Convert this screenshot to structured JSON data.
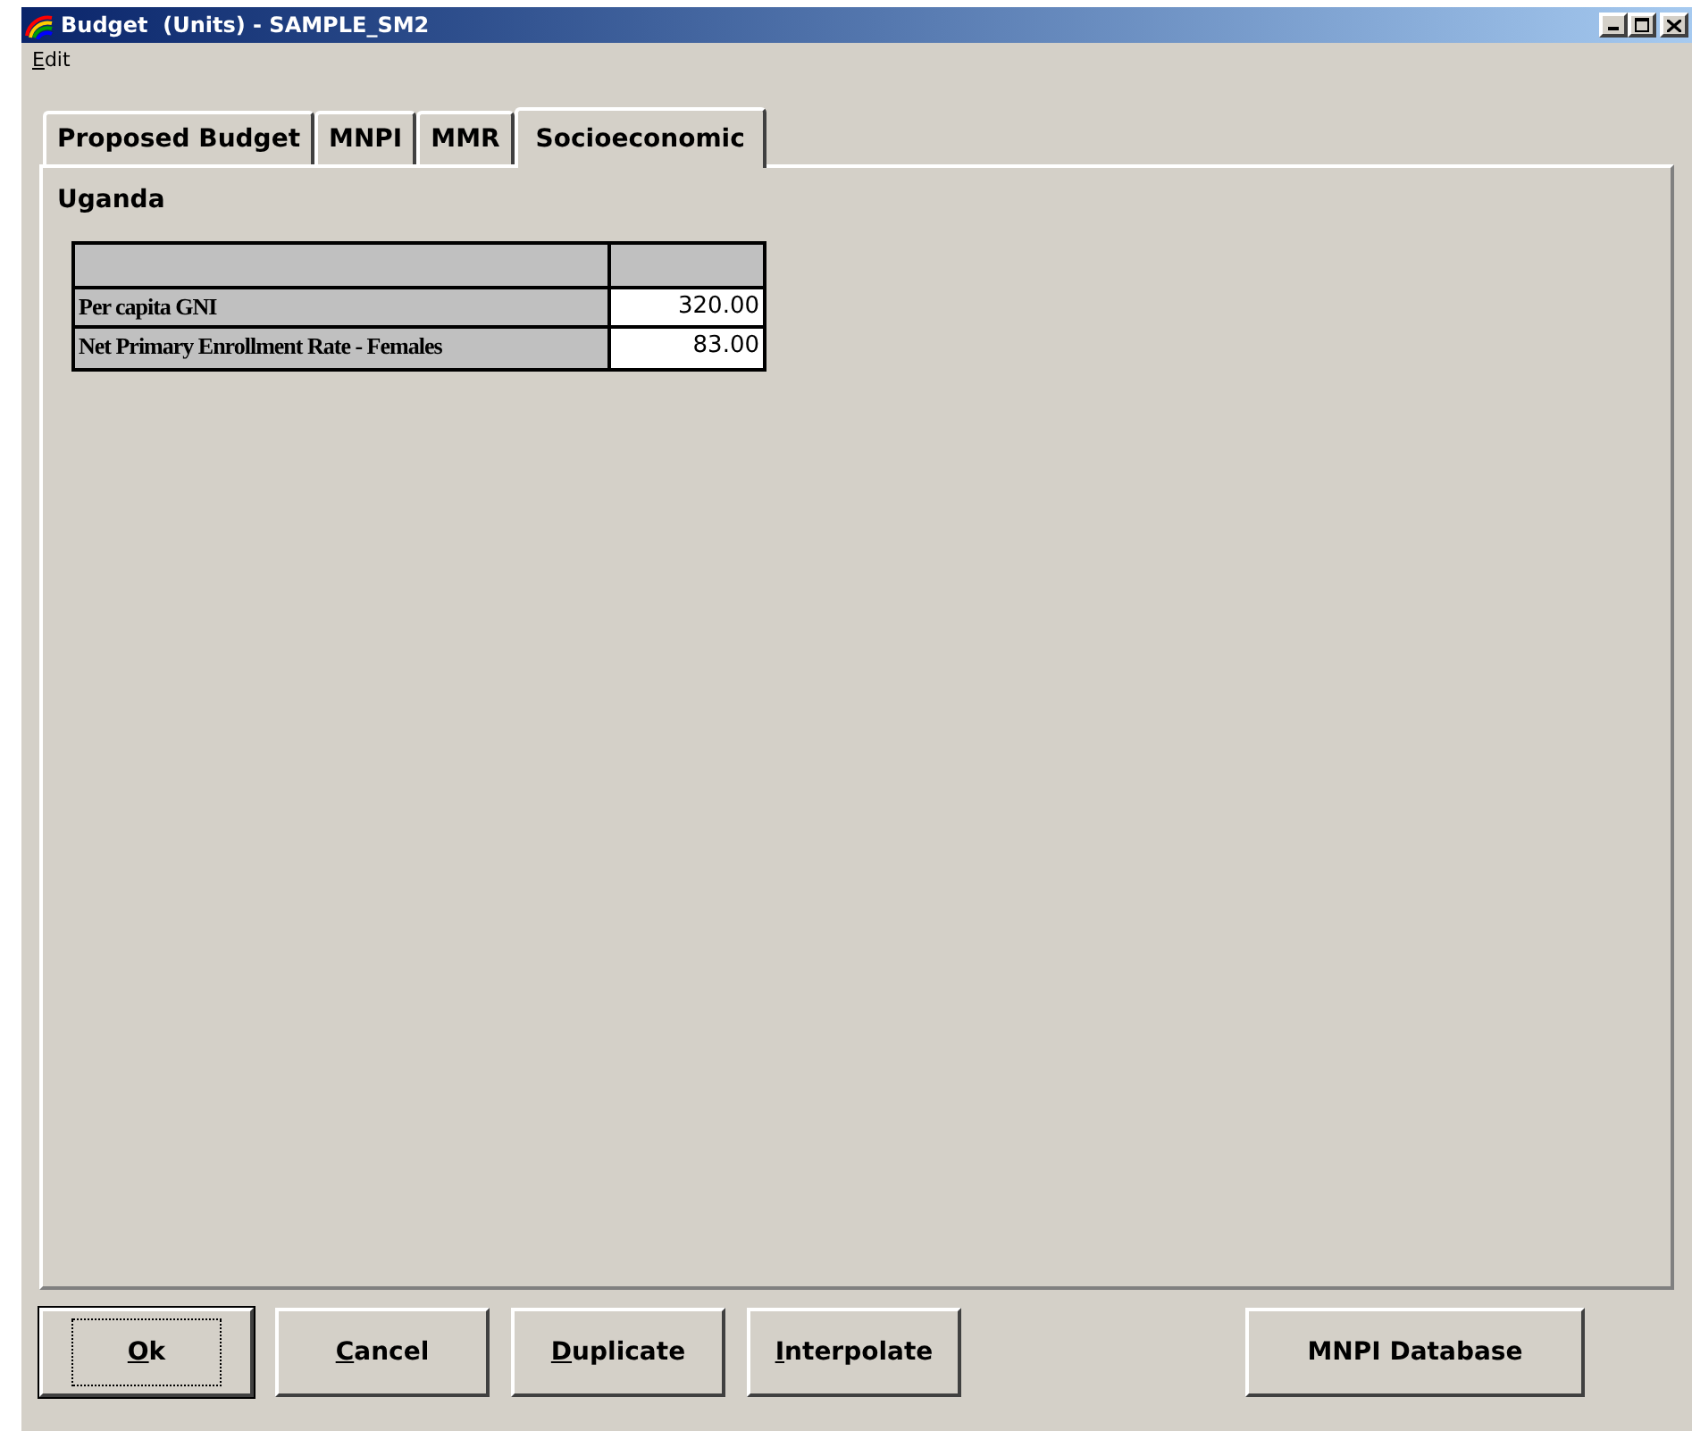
{
  "window": {
    "title": "Budget  (Units) - SAMPLE_SM2",
    "controls": [
      {
        "kind": "minimize"
      },
      {
        "kind": "maximize"
      },
      {
        "kind": "close"
      }
    ]
  },
  "menu": [
    {
      "mnemonic": "E",
      "rest": "dit"
    }
  ],
  "tabs": [
    {
      "label": "Proposed Budget",
      "selected": false
    },
    {
      "label": "MNPI",
      "selected": false
    },
    {
      "label": "MMR",
      "selected": false
    },
    {
      "label": "Socioeconomic",
      "selected": true
    }
  ],
  "country": "Uganda",
  "table": {
    "rows": [
      {
        "label": "Per capita GNI",
        "value": "320.00"
      },
      {
        "label": "Net Primary Enrollment Rate - Females",
        "value": "83.00"
      }
    ]
  },
  "buttons": [
    {
      "mnemonic": "O",
      "rest": "k",
      "default": true
    },
    {
      "mnemonic": "C",
      "rest": "ancel",
      "default": false
    },
    {
      "mnemonic": "D",
      "rest": "uplicate",
      "default": false
    },
    {
      "mnemonic": "I",
      "rest": "nterpolate",
      "default": false
    }
  ],
  "database_button": {
    "label": "MNPI Database"
  }
}
